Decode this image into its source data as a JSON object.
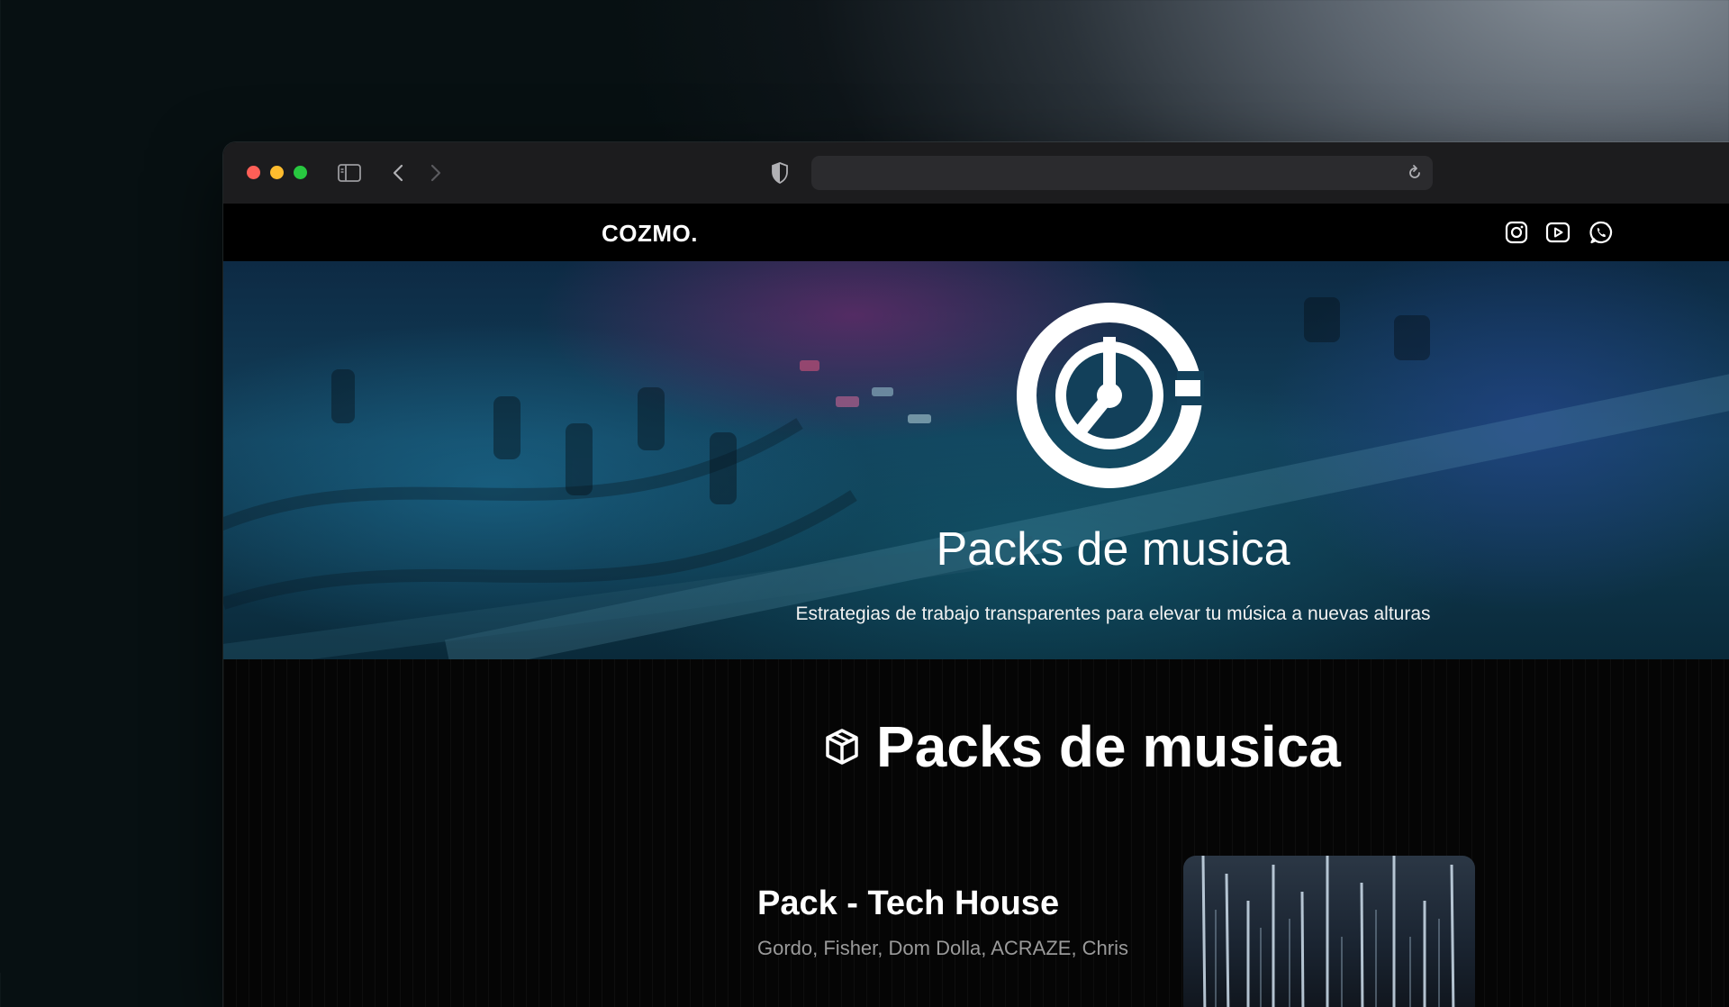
{
  "browser": {
    "icons": [
      "sidebar-icon",
      "back-arrow-icon",
      "forward-arrow-icon",
      "shield-icon",
      "reload-icon"
    ],
    "address_value": ""
  },
  "site": {
    "brand": "COZMO.",
    "social_icons": [
      "instagram-icon",
      "youtube-icon",
      "whatsapp-icon"
    ]
  },
  "hero": {
    "title": "Packs de musica",
    "subtitle": "Estrategias de trabajo transparentes para elevar tu música a nuevas alturas"
  },
  "section": {
    "title": "Packs de musica",
    "icon": "box-icon"
  },
  "pack": {
    "title": "Pack - Tech House",
    "artists": "Gordo, Fisher, Dom Dolla, ACRAZE, Chris"
  },
  "colors": {
    "traffic_red": "#ff5f57",
    "traffic_yellow": "#febc2e",
    "traffic_green": "#28c840",
    "header_bg": "#000000",
    "text_primary": "#ffffff",
    "text_muted": "#9a9a9a"
  }
}
